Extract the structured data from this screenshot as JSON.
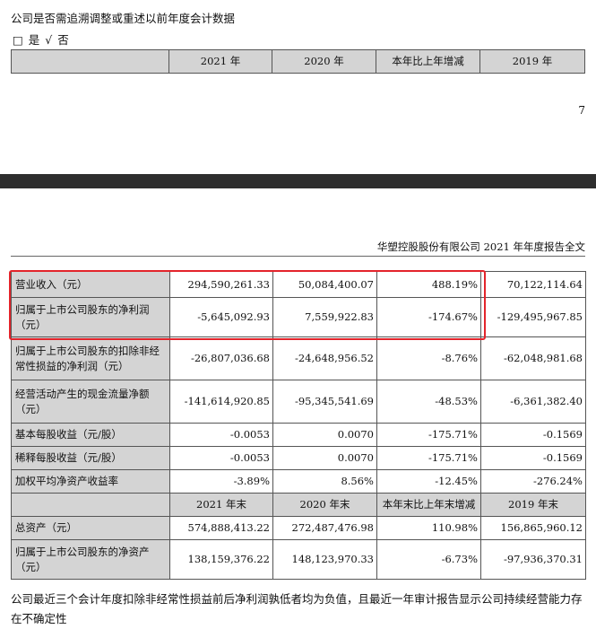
{
  "question": {
    "text": "公司是否需追溯调整或重述以前年度会计数据",
    "options": "□ 是 √ 否"
  },
  "top_table": {
    "headers": [
      "",
      "2021 年",
      "2020 年",
      "本年比上年增减",
      "2019 年"
    ]
  },
  "page_number": "7",
  "doc_title": "华塑控股股份有限公司 2021 年年度报告全文",
  "main_table": {
    "rows": [
      [
        "营业收入（元）",
        "294,590,261.33",
        "50,084,400.07",
        "488.19%",
        "70,122,114.64"
      ],
      [
        "归属于上市公司股东的净利润（元）",
        "-5,645,092.93",
        "7,559,922.83",
        "-174.67%",
        "-129,495,967.85"
      ],
      [
        "归属于上市公司股东的扣除非经常性损益的净利润（元）",
        "-26,807,036.68",
        "-24,648,956.52",
        "-8.76%",
        "-62,048,981.68"
      ],
      [
        "经营活动产生的现金流量净额（元）",
        "-141,614,920.85",
        "-95,345,541.69",
        "-48.53%",
        "-6,361,382.40"
      ],
      [
        "基本每股收益（元/股）",
        "-0.0053",
        "0.0070",
        "-175.71%",
        "-0.1569"
      ],
      [
        "稀释每股收益（元/股）",
        "-0.0053",
        "0.0070",
        "-175.71%",
        "-0.1569"
      ],
      [
        "加权平均净资产收益率",
        "-3.89%",
        "8.56%",
        "-12.45%",
        "-276.24%"
      ]
    ],
    "sub_headers": [
      "",
      "2021 年末",
      "2020 年末",
      "本年末比上年末增减",
      "2019 年末"
    ],
    "rows2": [
      [
        "总资产（元）",
        "574,888,413.22",
        "272,487,476.98",
        "110.98%",
        "156,865,960.12"
      ],
      [
        "归属于上市公司股东的净资产（元）",
        "138,159,376.22",
        "148,123,970.33",
        "-6.73%",
        "-97,936,370.31"
      ]
    ]
  },
  "highlight_color": "#e3242b",
  "footnote": "公司最近三个会计年度扣除非经常性损益前后净利润孰低者均为负值，且最近一年审计报告显示公司持续经营能力存在不确定性"
}
